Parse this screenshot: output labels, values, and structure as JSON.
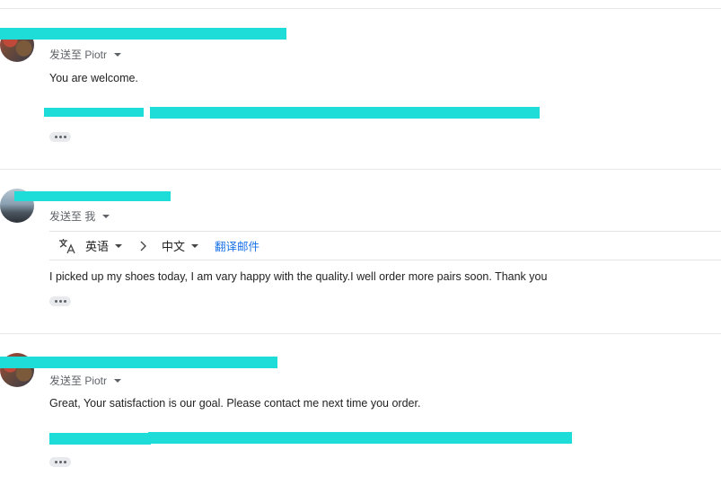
{
  "messages": [
    {
      "sent_to": "发送至 Piotr",
      "body": "You are welcome.",
      "more_label": "•••"
    },
    {
      "sent_to": "发送至 我",
      "translate": {
        "source_lang": "英语",
        "target_lang": "中文",
        "action": "翻译邮件"
      },
      "body": "I picked up my shoes today, I am vary happy with the quality.I well order  more pairs soon. Thank you",
      "more_label": "•••"
    },
    {
      "sent_to": "发送至 Piotr",
      "body": "Great, Your satisfaction is our goal. Please contact me next time you order.",
      "more_label": "•••"
    }
  ],
  "icons": [
    "translate-icon",
    "chevron-right-icon",
    "chevron-down-icon",
    "more-icon"
  ],
  "colors": {
    "redaction": "#1edcd8",
    "link": "#1a73e8",
    "muted": "#5f6368",
    "divider": "#e8e8e8"
  }
}
